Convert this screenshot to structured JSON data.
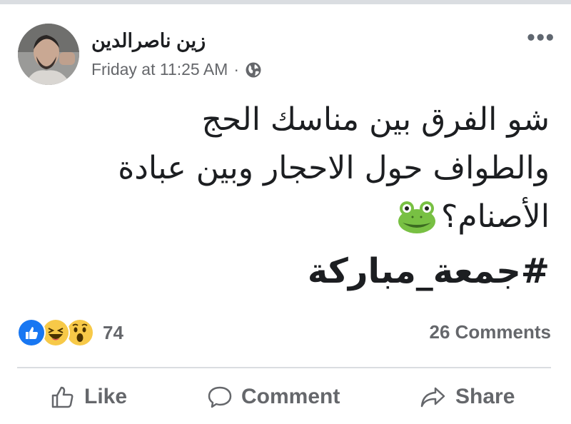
{
  "post": {
    "author": "زين ناصرالدين",
    "timestamp": "Friday at 11:25 AM",
    "separator": "·",
    "privacy_icon": "globe-icon",
    "menu_icon": "more-options-icon",
    "text_lines": [
      "شو الفرق بين مناسك الحج",
      "والطواف حول الاحجار وبين عبادة",
      "الأصنام؟"
    ],
    "emoji": "frog-face",
    "hashtag": "#جمعة_مباركة"
  },
  "engagement": {
    "reaction_icons": [
      "like-reaction-icon",
      "haha-reaction-icon",
      "wow-reaction-icon"
    ],
    "reaction_count": "74",
    "comments": "26 Comments"
  },
  "actions": {
    "like_label": "Like",
    "comment_label": "Comment",
    "share_label": "Share"
  },
  "colors": {
    "text": "#1c1e21",
    "muted": "#65676b",
    "like_blue": "#1877f2",
    "reaction_yellow": "#f7c948",
    "divider": "#dadde1"
  }
}
